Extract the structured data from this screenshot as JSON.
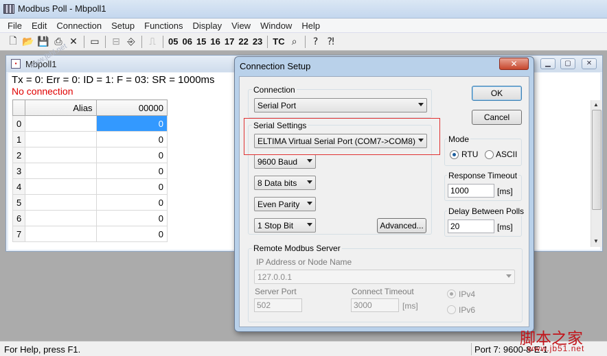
{
  "app": {
    "title": "Modbus Poll - Mbpoll1"
  },
  "menu": [
    "File",
    "Edit",
    "Connection",
    "Setup",
    "Functions",
    "Display",
    "View",
    "Window",
    "Help"
  ],
  "toolbar": {
    "function_codes": [
      "05",
      "06",
      "15",
      "16",
      "17",
      "22",
      "23"
    ],
    "tc_label": "TC",
    "icons": [
      "new-icon",
      "open-icon",
      "save-icon",
      "print-icon",
      "delete-icon",
      "window-icon",
      "connect-icon",
      "disconnect-icon",
      "pulse-icon",
      "scan-icon",
      "help-icon",
      "context-help-icon"
    ]
  },
  "child_window": {
    "title": "Mbpoll1",
    "status_line": "Tx = 0: Err = 0: ID = 1: F = 03: SR = 1000ms",
    "connection_status": "No connection",
    "grid": {
      "headers": [
        "",
        "Alias",
        "00000"
      ],
      "rows": [
        {
          "idx": "0",
          "alias": "",
          "value": "0"
        },
        {
          "idx": "1",
          "alias": "",
          "value": "0"
        },
        {
          "idx": "2",
          "alias": "",
          "value": "0"
        },
        {
          "idx": "3",
          "alias": "",
          "value": "0"
        },
        {
          "idx": "4",
          "alias": "",
          "value": "0"
        },
        {
          "idx": "5",
          "alias": "",
          "value": "0"
        },
        {
          "idx": "6",
          "alias": "",
          "value": "0"
        },
        {
          "idx": "7",
          "alias": "",
          "value": "0"
        }
      ]
    }
  },
  "dialog": {
    "title": "Connection Setup",
    "close_label": "✕",
    "connection": {
      "label": "Connection",
      "value": "Serial Port"
    },
    "serial_settings": {
      "label": "Serial Settings",
      "port": "ELTIMA Virtual Serial Port (COM7->COM8)",
      "baud": "9600 Baud",
      "data_bits": "8 Data bits",
      "parity": "Even Parity",
      "stop_bits": "1 Stop Bit",
      "advanced_label": "Advanced..."
    },
    "ok_label": "OK",
    "cancel_label": "Cancel",
    "mode": {
      "label": "Mode",
      "rtu": "RTU",
      "ascii": "ASCII",
      "selected": "RTU"
    },
    "response_timeout": {
      "label": "Response Timeout",
      "value": "1000",
      "unit": "[ms]"
    },
    "delay_between_polls": {
      "label": "Delay Between Polls",
      "value": "20",
      "unit": "[ms]"
    },
    "remote": {
      "label": "Remote Modbus Server",
      "ip_label": "IP Address or Node Name",
      "ip_value": "127.0.0.1",
      "server_port_label": "Server Port",
      "server_port_value": "502",
      "connect_timeout_label": "Connect Timeout",
      "connect_timeout_value": "3000",
      "connect_timeout_unit": "[ms]",
      "ipv4": "IPv4",
      "ipv6": "IPv6",
      "selected": "IPv4"
    }
  },
  "statusbar": {
    "help": "For Help, press F1.",
    "port": "Port 7: 9600-8-E-1"
  },
  "watermark": {
    "text": "脚本之家",
    "url": "www.jb51.net",
    "top_text": "www.jbbl.net"
  },
  "colors": {
    "selection": "#3399ff",
    "error_text": "#e00000",
    "highlight_box": "#e03030"
  }
}
